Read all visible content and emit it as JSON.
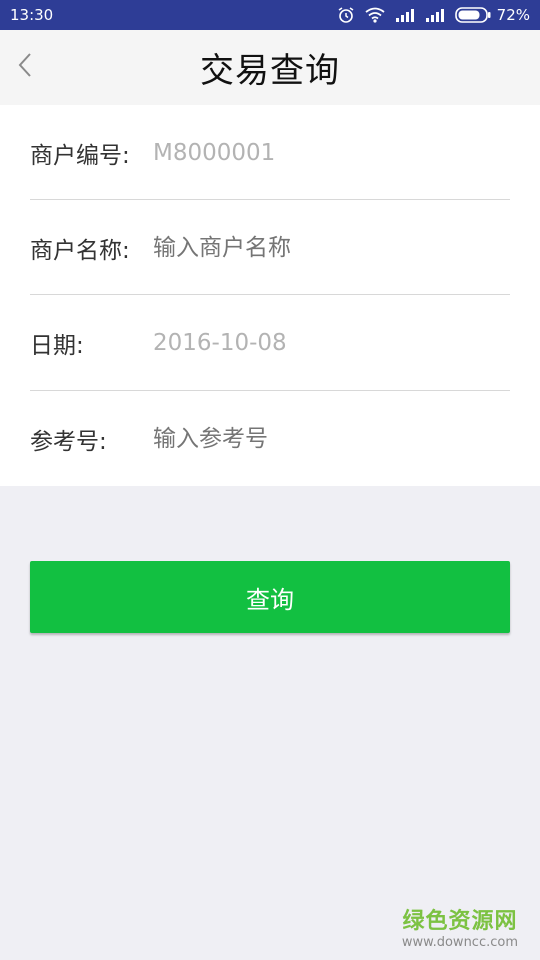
{
  "status_bar": {
    "time": "13:30",
    "battery_percent": "72%",
    "icons": [
      "alarm-icon",
      "wifi-icon",
      "signal-icon",
      "signal-icon",
      "battery-icon"
    ]
  },
  "nav": {
    "back_icon": "chevron-left-icon",
    "title": "交易查询"
  },
  "form": {
    "merchant_no": {
      "label": "商户编号:",
      "value": "M8000001"
    },
    "merchant_name": {
      "label": "商户名称:",
      "placeholder": "输入商户名称"
    },
    "date": {
      "label": "日期:",
      "value": "2016-10-08"
    },
    "reference_no": {
      "label": "参考号:",
      "placeholder": "输入参考号"
    }
  },
  "actions": {
    "query_label": "查询"
  },
  "watermark": {
    "main": "绿色资源网",
    "sub": "www.downcc.com"
  },
  "colors": {
    "status_bar": "#2e3d96",
    "primary_button": "#12c041",
    "background": "#efeff4",
    "placeholder": "#b3b3b3"
  }
}
